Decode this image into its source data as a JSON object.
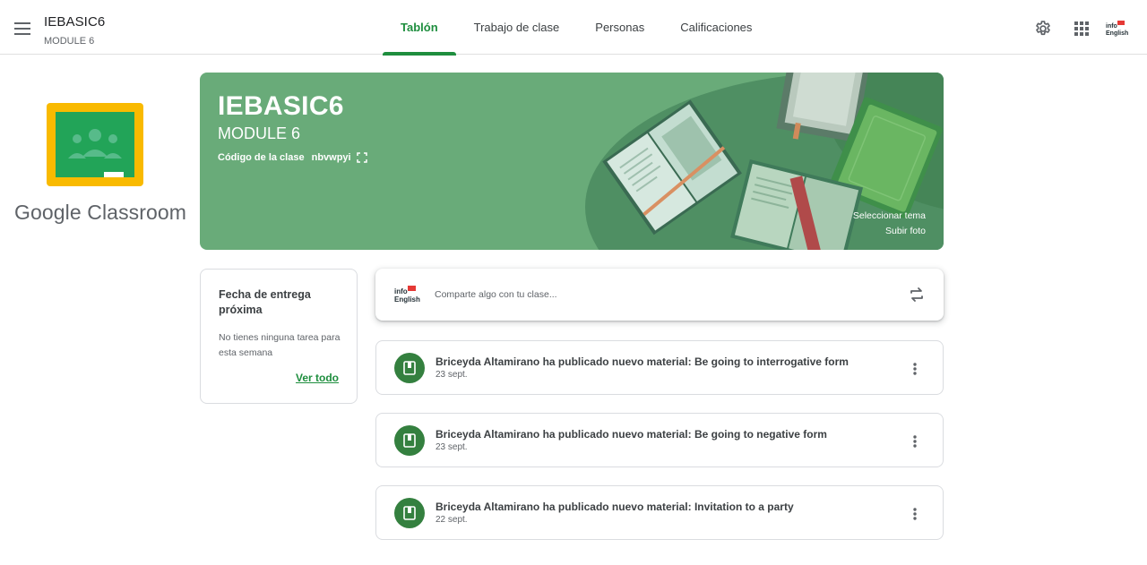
{
  "header": {
    "class_name": "IEBASIC6",
    "class_section": "MODULE 6",
    "tabs": [
      {
        "label": "Tablón",
        "active": true
      },
      {
        "label": "Trabajo de clase",
        "active": false
      },
      {
        "label": "Personas",
        "active": false
      },
      {
        "label": "Calificaciones",
        "active": false
      }
    ],
    "icons": [
      "menu-icon",
      "gear-icon",
      "apps-grid-icon"
    ],
    "account_logo_text": [
      "info",
      "English"
    ]
  },
  "brand": {
    "product_name": "Google Classroom",
    "accent_color": "#1e8e3e"
  },
  "banner": {
    "title": "IEBASIC6",
    "subtitle": "MODULE 6",
    "code_label": "Código de la clase",
    "code_value": "nbvwpyi",
    "select_theme": "Seleccionar tema",
    "upload_photo": "Subir foto",
    "color": "#69ab79"
  },
  "upcoming": {
    "title": "Fecha de entrega próxima",
    "empty_text": "No tienes ninguna tarea para esta semana",
    "view_all": "Ver todo"
  },
  "share": {
    "placeholder": "Comparte algo con tu clase..."
  },
  "posts": [
    {
      "text": "Briceyda Altamirano ha publicado nuevo material: Be going to interrogative form",
      "date": "23 sept."
    },
    {
      "text": "Briceyda Altamirano ha publicado nuevo material: Be going to negative form",
      "date": "23 sept."
    },
    {
      "text": "Briceyda Altamirano ha publicado nuevo material: Invitation to a party",
      "date": "22 sept."
    }
  ]
}
